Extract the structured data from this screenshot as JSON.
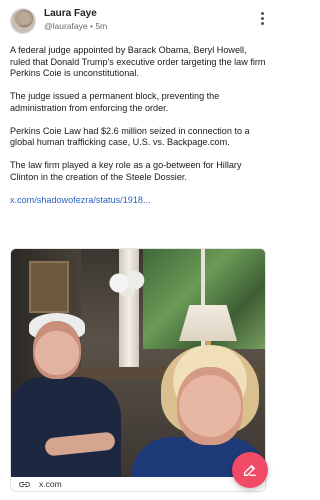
{
  "author": {
    "name": "Laura Faye",
    "handle": "@laurafaye",
    "separator": "•",
    "time": "5m"
  },
  "post": {
    "paragraphs": [
      "A federal judge appointed by Barack Obama, Beryl Howell, ruled that Donald Trump's executive order targeting the law firm Perkins Coie is unconstitutional.",
      "The judge issued a permanent block, preventing the administration from enforcing the order.",
      "Perkins Coie Law had $2.6 million seized in connection to a global human trafficking case, U.S. vs. Backpage.com.",
      "The law firm played a key role as a go-between for Hillary Clinton in the creation of the Steele Dossier."
    ],
    "link": "x.com/shadowofezra/status/1918..."
  },
  "card": {
    "domain": "x.com"
  },
  "icons": {
    "more": "more-vertical-icon",
    "link": "link-icon",
    "compose": "compose-icon"
  },
  "colors": {
    "link": "#2c63c5",
    "fab": "#ef4a66"
  }
}
